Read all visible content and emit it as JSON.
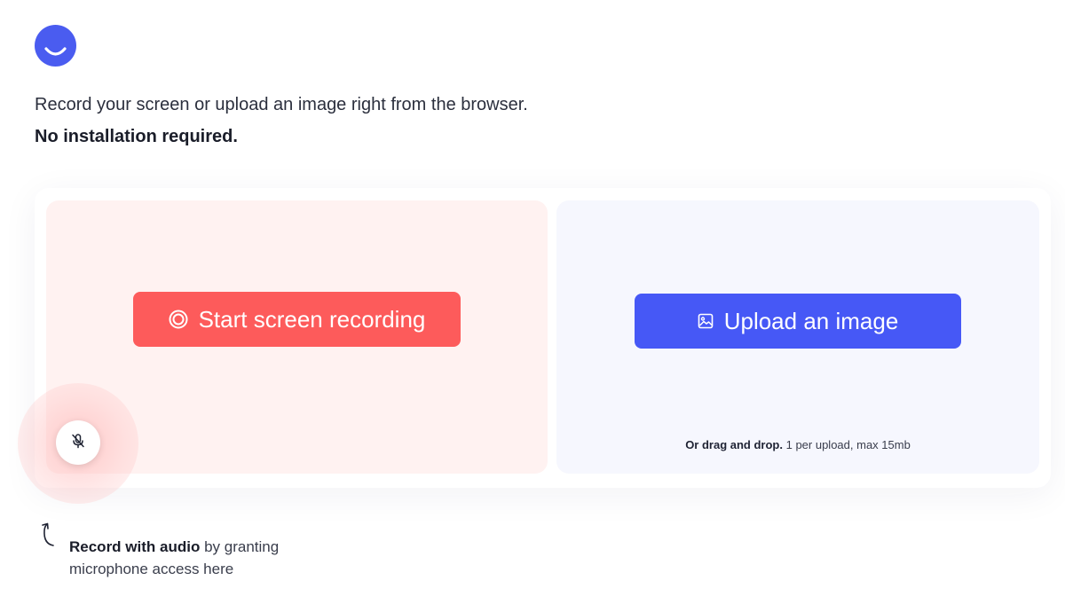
{
  "brand": {
    "logo_icon": "smile-logo-icon",
    "color": "#4a5cf0"
  },
  "intro": {
    "text": "Record your screen or upload an image right from the browser.",
    "emphasis": "No installation required."
  },
  "record": {
    "button_label": "Start screen recording",
    "button_icon": "record-icon",
    "button_color": "#fd5b5b",
    "card_color": "#fff2f1"
  },
  "upload": {
    "button_label": "Upload an image",
    "button_icon": "image-icon",
    "button_color": "#4658f6",
    "card_color": "#f6f7fe",
    "drop_hint_bold": "Or drag and drop.",
    "drop_hint_rest": "1 per upload, max 15mb"
  },
  "microphone": {
    "icon": "mic-off-icon"
  },
  "audio_hint": {
    "bold": "Record with audio",
    "rest": "by granting microphone access here",
    "arrow_icon": "curved-arrow-up-icon"
  }
}
